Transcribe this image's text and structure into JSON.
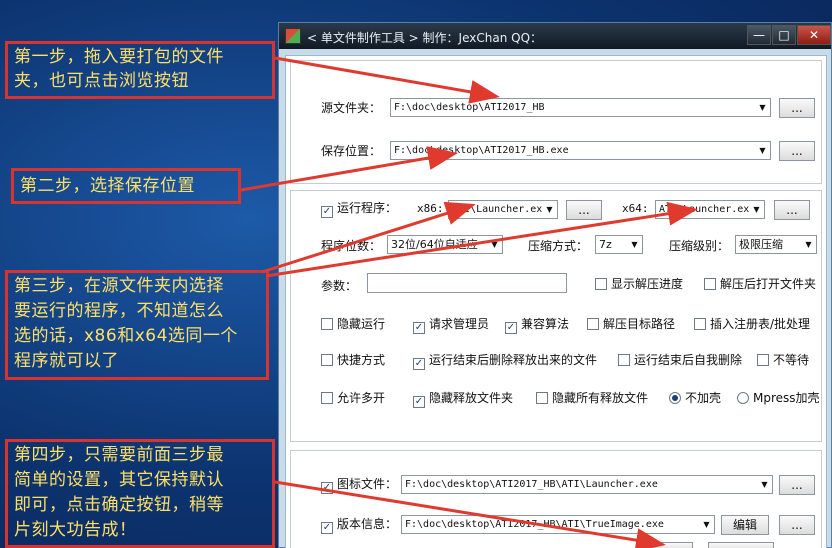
{
  "callouts": {
    "step1": [
      "第一步，拖入要打包的文件",
      "夹，也可点击浏览按钮"
    ],
    "step2": "第二步，选择保存位置",
    "step3": [
      "第三步，在源文件夹内选择",
      "要运行的程序，不知道怎么",
      "选的话，x86和x64选同一个",
      "程序就可以了"
    ],
    "step4": [
      "第四步，只需要前面三步最",
      "简单的设置，其它保持默认",
      "即可，点击确定按钮，稍等",
      "片刻大功告成！"
    ]
  },
  "window": {
    "title": "< 单文件制作工具 > 制作：JexChan  QQ：",
    "min": "—",
    "max": "□",
    "close": "✕"
  },
  "source": {
    "label": "源文件夹：",
    "value": "F:\\doc\\desktop\\ATI2017_HB",
    "browse": "..."
  },
  "save": {
    "label": "保存位置：",
    "value": "F:\\doc\\desktop\\ATI2017_HB.exe",
    "browse": "..."
  },
  "run": {
    "check_label": "运行程序：",
    "x86_label": "x86:",
    "x86_value": "ATI\\Launcher.ex",
    "x64_label": "x64:",
    "x64_value": "ATI\\Launcher.ex",
    "browse": "..."
  },
  "bits": {
    "label": "程序位数：",
    "value": "32位/64位自适应"
  },
  "compress": {
    "method_label": "压缩方式：",
    "method_value": "7z",
    "level_label": "压缩级别：",
    "level_value": "极限压缩"
  },
  "params": {
    "label": "参数：",
    "value": ""
  },
  "options": {
    "show_progress": "显示解压进度",
    "open_after": "解压后打开文件夹",
    "hide_run": "隐藏运行",
    "request_admin": "请求管理员",
    "compat": "兼容算法",
    "extract_path": "解压目标路径",
    "reg_batch": "插入注册表/批处理",
    "shortcut": "快捷方式",
    "delete_after": "运行结束后删除释放出来的文件",
    "self_delete": "运行结束后自我删除",
    "no_wait": "不等待",
    "multi": "允许多开",
    "hide_folder": "隐藏释放文件夹",
    "hide_all": "隐藏所有释放文件",
    "no_pack": "不加壳",
    "mpress": "Mpress加壳"
  },
  "icon": {
    "label": "图标文件：",
    "value": "F:\\doc\\desktop\\ATI2017_HB\\ATI\\Launcher.exe",
    "browse": "..."
  },
  "version": {
    "label": "版本信息：",
    "value": "F:\\doc\\desktop\\ATI2017_HB\\ATI\\TrueImage.exe",
    "edit": "编辑",
    "browse": "..."
  },
  "colors": {
    "accent": "#d8332e",
    "callout_text": "#ffe066",
    "window_bg": "#c8dbe9"
  }
}
